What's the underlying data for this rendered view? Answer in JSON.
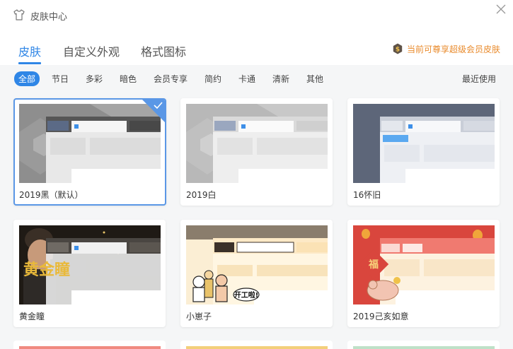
{
  "window": {
    "title": "皮肤中心"
  },
  "tabs": [
    {
      "label": "皮肤",
      "active": true
    },
    {
      "label": "自定义外观",
      "active": false
    },
    {
      "label": "格式图标",
      "active": false
    }
  ],
  "vip_notice": "当前可尊享超级会员皮肤",
  "filters": [
    {
      "label": "全部",
      "active": true
    },
    {
      "label": "节日",
      "active": false
    },
    {
      "label": "多彩",
      "active": false
    },
    {
      "label": "暗色",
      "active": false
    },
    {
      "label": "会员专享",
      "active": false
    },
    {
      "label": "简约",
      "active": false
    },
    {
      "label": "卡通",
      "active": false
    },
    {
      "label": "清新",
      "active": false
    },
    {
      "label": "其他",
      "active": false
    }
  ],
  "recent_label": "最近使用",
  "skins": [
    {
      "name": "2019黑（默认）",
      "selected": true
    },
    {
      "name": "2019白",
      "selected": false
    },
    {
      "name": "16怀旧",
      "selected": false
    },
    {
      "name": "黄金瞳",
      "selected": false
    },
    {
      "name": "小崽子",
      "selected": false
    },
    {
      "name": "2019己亥如意",
      "selected": false
    }
  ],
  "thumb_text": {
    "golden_eye": "黄金瞳",
    "cartoon_bubble": "开工啦!",
    "fortune": "福"
  },
  "colors": {
    "accent": "#2f86e6",
    "vip": "#e98b2d",
    "peek_colors": [
      "#f08a80",
      "#f3cf7a",
      "#bfe1c8"
    ]
  }
}
